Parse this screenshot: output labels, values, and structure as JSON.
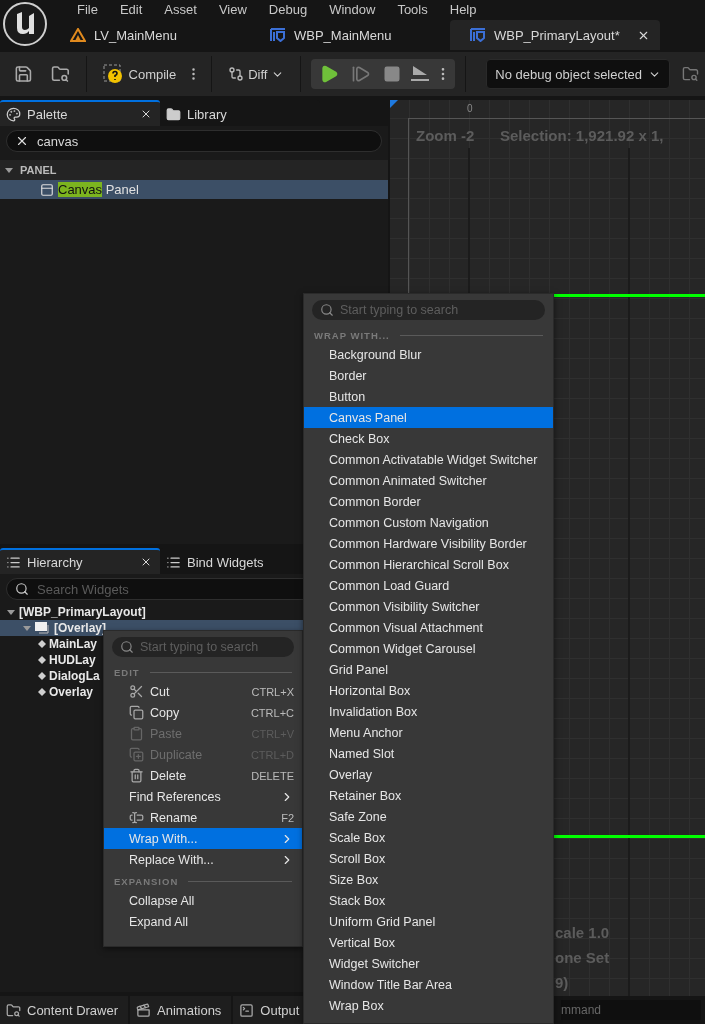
{
  "menu_bar": [
    "File",
    "Edit",
    "Asset",
    "View",
    "Debug",
    "Window",
    "Tools",
    "Help"
  ],
  "document_tabs": [
    {
      "label": "LV_MainMenu",
      "kind": "level",
      "selected": false
    },
    {
      "label": "WBP_MainMenu",
      "kind": "widget",
      "selected": false
    },
    {
      "label": "WBP_PrimaryLayout*",
      "kind": "widget",
      "selected": true
    }
  ],
  "toolbar": {
    "compile": "Compile",
    "diff": "Diff",
    "debug_object": "No debug object selected"
  },
  "palette": {
    "tabs": [
      {
        "label": "Palette",
        "kind": "palette",
        "selected": true
      },
      {
        "label": "Library",
        "kind": "library",
        "selected": false
      }
    ],
    "search": {
      "value": "canvas"
    },
    "categories": [
      {
        "label": "PANEL",
        "expanded": true,
        "items": [
          {
            "match": "Canvas",
            "label": "Panel",
            "selected": true
          }
        ]
      }
    ]
  },
  "canvas": {
    "ruler_label": "0",
    "zoom": "Zoom -2",
    "selection": "Selection: 1,921.92 x 1,",
    "info_lines": [
      "cale 1.0",
      "one Set",
      "9)"
    ]
  },
  "hierarchy": {
    "tabs": [
      {
        "label": "Hierarchy",
        "selected": true
      },
      {
        "label": "Bind Widgets",
        "selected": false
      }
    ],
    "search": {
      "placeholder": "Search Widgets"
    },
    "tree": [
      {
        "label": "[WBP_PrimaryLayout]",
        "selected": false,
        "expanded": true,
        "children": [
          {
            "label": "[Overlay]",
            "kind": "overlay",
            "selected": true,
            "expanded": true,
            "children": [
              {
                "label": "MainLay",
                "kind": "slot",
                "selected": false
              },
              {
                "label": "HUDLay",
                "kind": "slot",
                "selected": false
              },
              {
                "label": "DialogLa",
                "kind": "slot",
                "selected": false
              },
              {
                "label": "Overlay",
                "kind": "slot",
                "selected": false
              }
            ]
          }
        ]
      }
    ]
  },
  "context_menu": {
    "search": {
      "placeholder": "Start typing to search"
    },
    "sections": [
      {
        "title": "EDIT",
        "items": [
          {
            "label": "Cut",
            "kind": "cut",
            "shortcut": "CTRL+X",
            "disabled": false,
            "submenu": false,
            "selected": false
          },
          {
            "label": "Copy",
            "kind": "copy",
            "shortcut": "CTRL+C",
            "disabled": false,
            "submenu": false,
            "selected": false
          },
          {
            "label": "Paste",
            "kind": "paste",
            "shortcut": "CTRL+V",
            "disabled": true,
            "submenu": false,
            "selected": false
          },
          {
            "label": "Duplicate",
            "kind": "duplicate",
            "shortcut": "CTRL+D",
            "disabled": true,
            "submenu": false,
            "selected": false
          },
          {
            "label": "Delete",
            "kind": "delete",
            "shortcut": "DELETE",
            "disabled": false,
            "submenu": false,
            "selected": false
          },
          {
            "label": "Find References",
            "disabled": false,
            "submenu": true,
            "selected": false
          },
          {
            "label": "Rename",
            "kind": "rename",
            "shortcut": "F2",
            "disabled": false,
            "submenu": false,
            "selected": false
          },
          {
            "label": "Wrap With...",
            "disabled": false,
            "submenu": true,
            "selected": true
          },
          {
            "label": "Replace With...",
            "disabled": false,
            "submenu": true,
            "selected": false
          }
        ]
      },
      {
        "title": "EXPANSION",
        "items": [
          {
            "label": "Collapse All",
            "disabled": false,
            "submenu": false,
            "selected": false
          },
          {
            "label": "Expand All",
            "disabled": false,
            "submenu": false,
            "selected": false
          }
        ]
      }
    ]
  },
  "wrap_with_menu": {
    "search": {
      "placeholder": "Start typing to search"
    },
    "title": "WRAP WITH...",
    "items": [
      {
        "label": "Background Blur",
        "selected": false
      },
      {
        "label": "Border",
        "selected": false
      },
      {
        "label": "Button",
        "selected": false
      },
      {
        "label": "Canvas Panel",
        "selected": true
      },
      {
        "label": "Check Box",
        "selected": false
      },
      {
        "label": "Common Activatable Widget Switcher",
        "selected": false
      },
      {
        "label": "Common Animated Switcher",
        "selected": false
      },
      {
        "label": "Common Border",
        "selected": false
      },
      {
        "label": "Common Custom Navigation",
        "selected": false
      },
      {
        "label": "Common Hardware Visibility Border",
        "selected": false
      },
      {
        "label": "Common Hierarchical Scroll Box",
        "selected": false
      },
      {
        "label": "Common Load Guard",
        "selected": false
      },
      {
        "label": "Common Visibility Switcher",
        "selected": false
      },
      {
        "label": "Common Visual Attachment",
        "selected": false
      },
      {
        "label": "Common Widget Carousel",
        "selected": false
      },
      {
        "label": "Grid Panel",
        "selected": false
      },
      {
        "label": "Horizontal Box",
        "selected": false
      },
      {
        "label": "Invalidation Box",
        "selected": false
      },
      {
        "label": "Menu Anchor",
        "selected": false
      },
      {
        "label": "Named Slot",
        "selected": false
      },
      {
        "label": "Overlay",
        "selected": false
      },
      {
        "label": "Retainer Box",
        "selected": false
      },
      {
        "label": "Safe Zone",
        "selected": false
      },
      {
        "label": "Scale Box",
        "selected": false
      },
      {
        "label": "Scroll Box",
        "selected": false
      },
      {
        "label": "Size Box",
        "selected": false
      },
      {
        "label": "Stack Box",
        "selected": false
      },
      {
        "label": "Uniform Grid Panel",
        "selected": false
      },
      {
        "label": "Vertical Box",
        "selected": false
      },
      {
        "label": "Widget Switcher",
        "selected": false
      },
      {
        "label": "Window Title Bar Area",
        "selected": false
      },
      {
        "label": "Wrap Box",
        "selected": false
      }
    ]
  },
  "bottom_bar": {
    "items": [
      {
        "label": "Content Drawer",
        "kind": "drawer"
      },
      {
        "label": "Animations",
        "kind": "animations"
      },
      {
        "label": "Output",
        "kind": "output"
      }
    ],
    "command": {
      "value": "mmand"
    }
  }
}
